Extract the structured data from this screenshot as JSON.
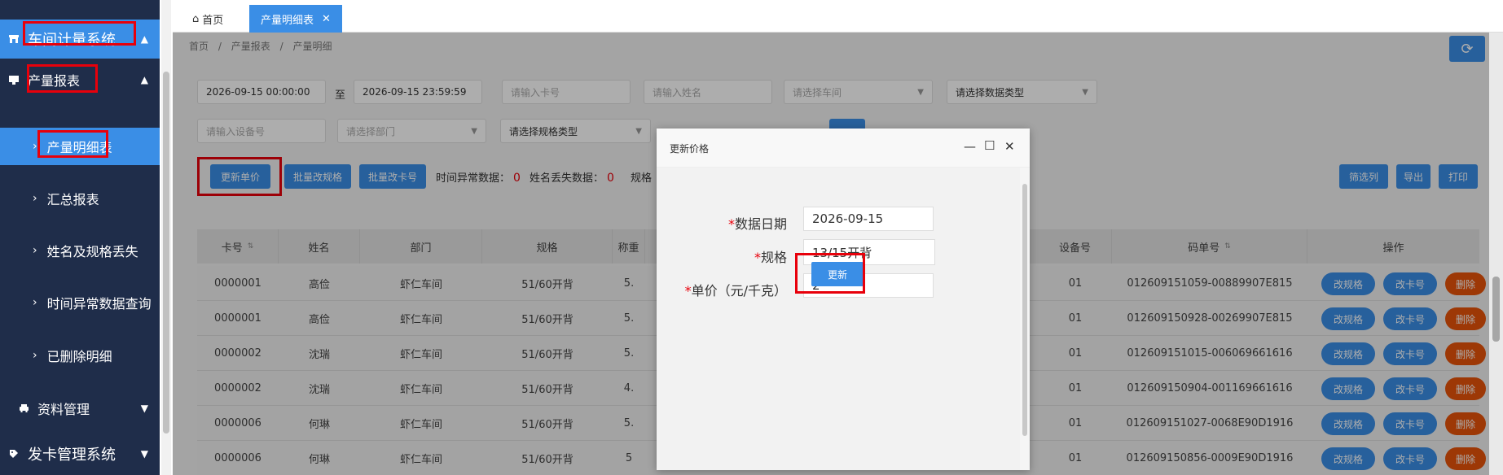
{
  "sidebar": {
    "system_title": "车间计量系统",
    "group_production": "产量报表",
    "items": [
      {
        "label": "产量明细表"
      },
      {
        "label": "汇总报表"
      },
      {
        "label": "姓名及规格丢失"
      },
      {
        "label": "时间异常数据查询"
      },
      {
        "label": "已删除明细"
      }
    ],
    "group_data": "资料管理",
    "group_card": "发卡管理系统"
  },
  "tabs": {
    "home": "首页",
    "active": "产量明细表"
  },
  "breadcrumb": {
    "home": "首页",
    "sep": "/",
    "level1": "产量报表",
    "level2": "产量明细"
  },
  "filters": {
    "start_time": "2026-09-15 00:00:00",
    "to": "至",
    "end_time": "2026-09-15 23:59:59",
    "card_placeholder": "请输入卡号",
    "name_placeholder": "请输入姓名",
    "workshop_placeholder": "请选择车间",
    "datatype_placeholder": "请选择数据类型",
    "device_placeholder": "请输入设备号",
    "dept_placeholder": "请选择部门",
    "spec_placeholder": "请选择规格类型"
  },
  "toolbar": {
    "update_price": "更新单价",
    "batch_spec": "批量改规格",
    "batch_card": "批量改卡号",
    "time_abnormal_label": "时间异常数据：",
    "time_abnormal_count": "0",
    "name_lost_label": "姓名丢失数据：",
    "name_lost_count": "0",
    "spec_partial": "规格",
    "filter_cols": "筛选列",
    "export": "导出",
    "print": "打印"
  },
  "table": {
    "headers": {
      "card": "卡号",
      "name": "姓名",
      "dept": "部门",
      "spec": "规格",
      "weight": "称重",
      "device": "设备号",
      "code": "码单号",
      "ops": "操作"
    },
    "rows": [
      {
        "card": "0000001",
        "name": "高俭",
        "dept": "虾仁车间",
        "spec": "51/60开背",
        "weight": "5.",
        "device": "01",
        "code": "012609151059-00889907E815"
      },
      {
        "card": "0000001",
        "name": "高俭",
        "dept": "虾仁车间",
        "spec": "51/60开背",
        "weight": "5.",
        "device": "01",
        "code": "012609150928-00269907E815"
      },
      {
        "card": "0000002",
        "name": "沈瑞",
        "dept": "虾仁车间",
        "spec": "51/60开背",
        "weight": "5.",
        "device": "01",
        "code": "012609151015-006069661616"
      },
      {
        "card": "0000002",
        "name": "沈瑞",
        "dept": "虾仁车间",
        "spec": "51/60开背",
        "weight": "4.",
        "device": "01",
        "code": "012609150904-001169661616"
      },
      {
        "card": "0000006",
        "name": "何琳",
        "dept": "虾仁车间",
        "spec": "51/60开背",
        "weight": "5.",
        "device": "01",
        "code": "012609151027-0068E90D1916"
      },
      {
        "card": "0000006",
        "name": "何琳",
        "dept": "虾仁车间",
        "spec": "51/60开背",
        "weight": "5",
        "device": "01",
        "code": "012609150856-0009E90D1916"
      }
    ],
    "actions": {
      "edit_spec": "改规格",
      "edit_card": "改卡号",
      "delete": "删除"
    }
  },
  "dialog": {
    "title": "更新价格",
    "date_label": "数据日期",
    "date_value": "2026-09-15",
    "spec_label": "规格",
    "spec_value": "13/15开背",
    "price_label": "单价（元/千克）",
    "price_value": "2",
    "submit": "更新",
    "required_mark": "*"
  },
  "colors": {
    "sidebar_bg": "#1f2d4a",
    "accent": "#3a8ee6",
    "danger": "#e8530a",
    "highlight_box": "#e8000b"
  }
}
